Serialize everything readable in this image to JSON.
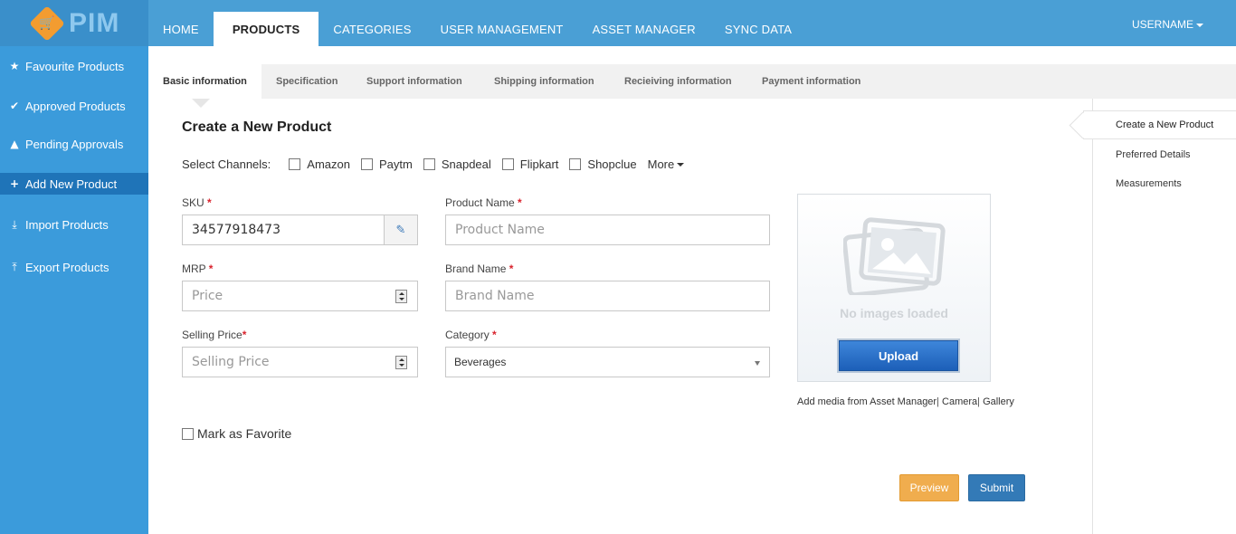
{
  "app": {
    "logo_text": "PIM"
  },
  "topnav": {
    "items": [
      "HOME",
      "PRODUCTS",
      "CATEGORIES",
      "USER MANAGEMENT",
      "ASSET MANAGER",
      "SYNC DATA"
    ],
    "active": "PRODUCTS",
    "username": "USERNAME"
  },
  "sidebar": {
    "items": [
      {
        "label": "Favourite Products",
        "icon": "star-icon"
      },
      {
        "label": "Approved Products",
        "icon": "check-icon"
      },
      {
        "label": "Pending Approvals",
        "icon": "warning-icon"
      },
      {
        "label": "Add New Product",
        "icon": "plus-icon",
        "active": true
      },
      {
        "label": "Import Products",
        "icon": "import-icon"
      },
      {
        "label": "Export Products",
        "icon": "export-icon"
      }
    ]
  },
  "subtabs": {
    "items": [
      "Basic information",
      "Specification",
      "Support information",
      "Shipping information",
      "Recieiving information",
      "Payment information"
    ],
    "active": "Basic information"
  },
  "form": {
    "title": "Create a New Product",
    "channels_label": "Select Channels:",
    "channels": [
      "Amazon",
      "Paytm",
      "Snapdeal",
      "Flipkart",
      "Shopclue"
    ],
    "more_label": "More",
    "sku_label": "SKU",
    "sku_value": "34577918473",
    "product_name_label": "Product Name",
    "product_name_placeholder": "Product Name",
    "mrp_label": "MRP",
    "mrp_placeholder": "Price",
    "brand_name_label": "Brand Name",
    "brand_name_placeholder": "Brand Name",
    "selling_price_label": "Selling Price",
    "selling_price_placeholder": "Selling Price",
    "category_label": "Category",
    "category_value": "Beverages",
    "favorite_label": "Mark as Favorite",
    "required_mark": "*"
  },
  "media": {
    "no_images_text": "No images loaded",
    "upload_label": "Upload",
    "links_prefix": "Add media from",
    "links": [
      "Asset Manager",
      "Camera",
      "Gallery"
    ]
  },
  "actions": {
    "preview_label": "Preview",
    "submit_label": "Submit"
  },
  "right_panel": {
    "items": [
      "Create a New Product",
      "Preferred Details",
      "Measurements"
    ]
  },
  "colors": {
    "nav_bg": "#4a9fd5",
    "sidebar_bg": "#3b9bdb",
    "sidebar_active": "#1f74b8",
    "preview_btn": "#f0ad4e",
    "submit_btn": "#337ab7",
    "required": "#d9232d",
    "logo_badge": "#f39c30"
  }
}
